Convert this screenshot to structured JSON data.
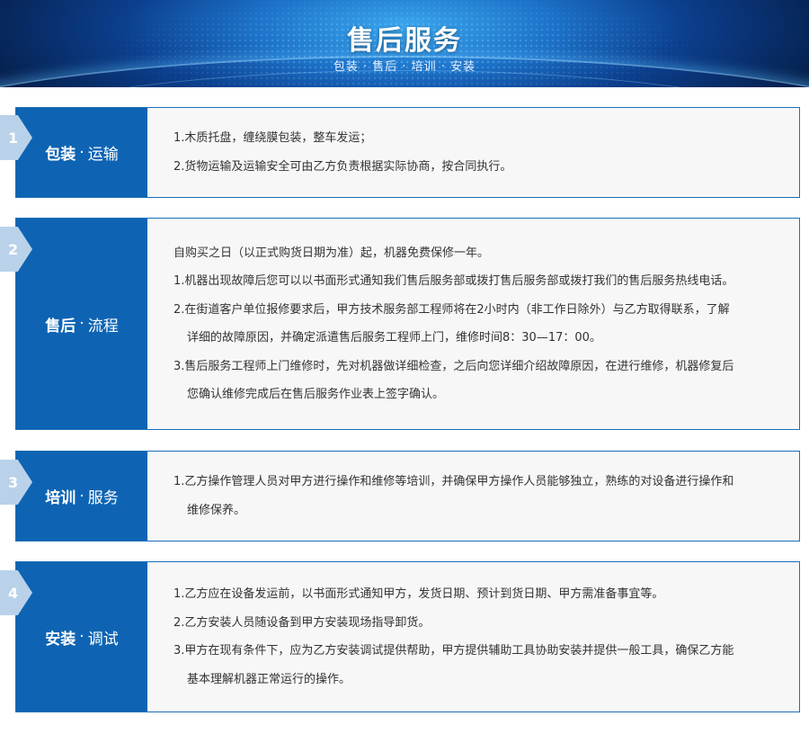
{
  "banner": {
    "title": "售后服务",
    "subtitle": "包装 · 售后 · 培训 · 安装"
  },
  "sections": [
    {
      "number": "1",
      "title_bold": "包装",
      "title_rest": "运输",
      "lines": [
        "1.木质托盘，缠绕膜包装，整车发运；",
        "2.货物运输及运输安全可由乙方负责根据实际协商，按合同执行。"
      ]
    },
    {
      "number": "2",
      "title_bold": "售后",
      "title_rest": "流程",
      "lines": [
        "自购买之日（以正式购货日期为准）起，机器免费保修一年。",
        "1.机器出现故障后您可以以书面形式通知我们售后服务部或拨打售后服务部或拨打我们的售后服务热线电话。",
        "2.在街道客户单位报修要求后，甲方技术服务部工程师将在2小时内（非工作日除外）与乙方取得联系，了解",
        "详细的故障原因，并确定派遣售后服务工程师上门，维修时间8：30—17：00。",
        "3.售后服务工程师上门维修时，先对机器做详细检查，之后向您详细介绍故障原因，在进行维修，机器修复后",
        "您确认维修完成后在售后服务作业表上签字确认。"
      ]
    },
    {
      "number": "3",
      "title_bold": "培训",
      "title_rest": "服务",
      "lines": [
        "1.乙方操作管理人员对甲方进行操作和维修等培训，并确保甲方操作人员能够独立，熟练的对设备进行操作和",
        "维修保养。"
      ]
    },
    {
      "number": "4",
      "title_bold": "安装",
      "title_rest": "调试",
      "lines": [
        "1.乙方应在设备发运前，以书面形式通知甲方，发货日期、预计到货日期、甲方需准备事宜等。",
        "2.乙方安装人员随设备到甲方安装现场指导卸货。",
        "3.甲方在现有条件下，应为乙方安装调试提供帮助，甲方提供辅助工具协助安装并提供一般工具，确保乙方能",
        "基本理解机器正常运行的操作。"
      ]
    }
  ]
}
